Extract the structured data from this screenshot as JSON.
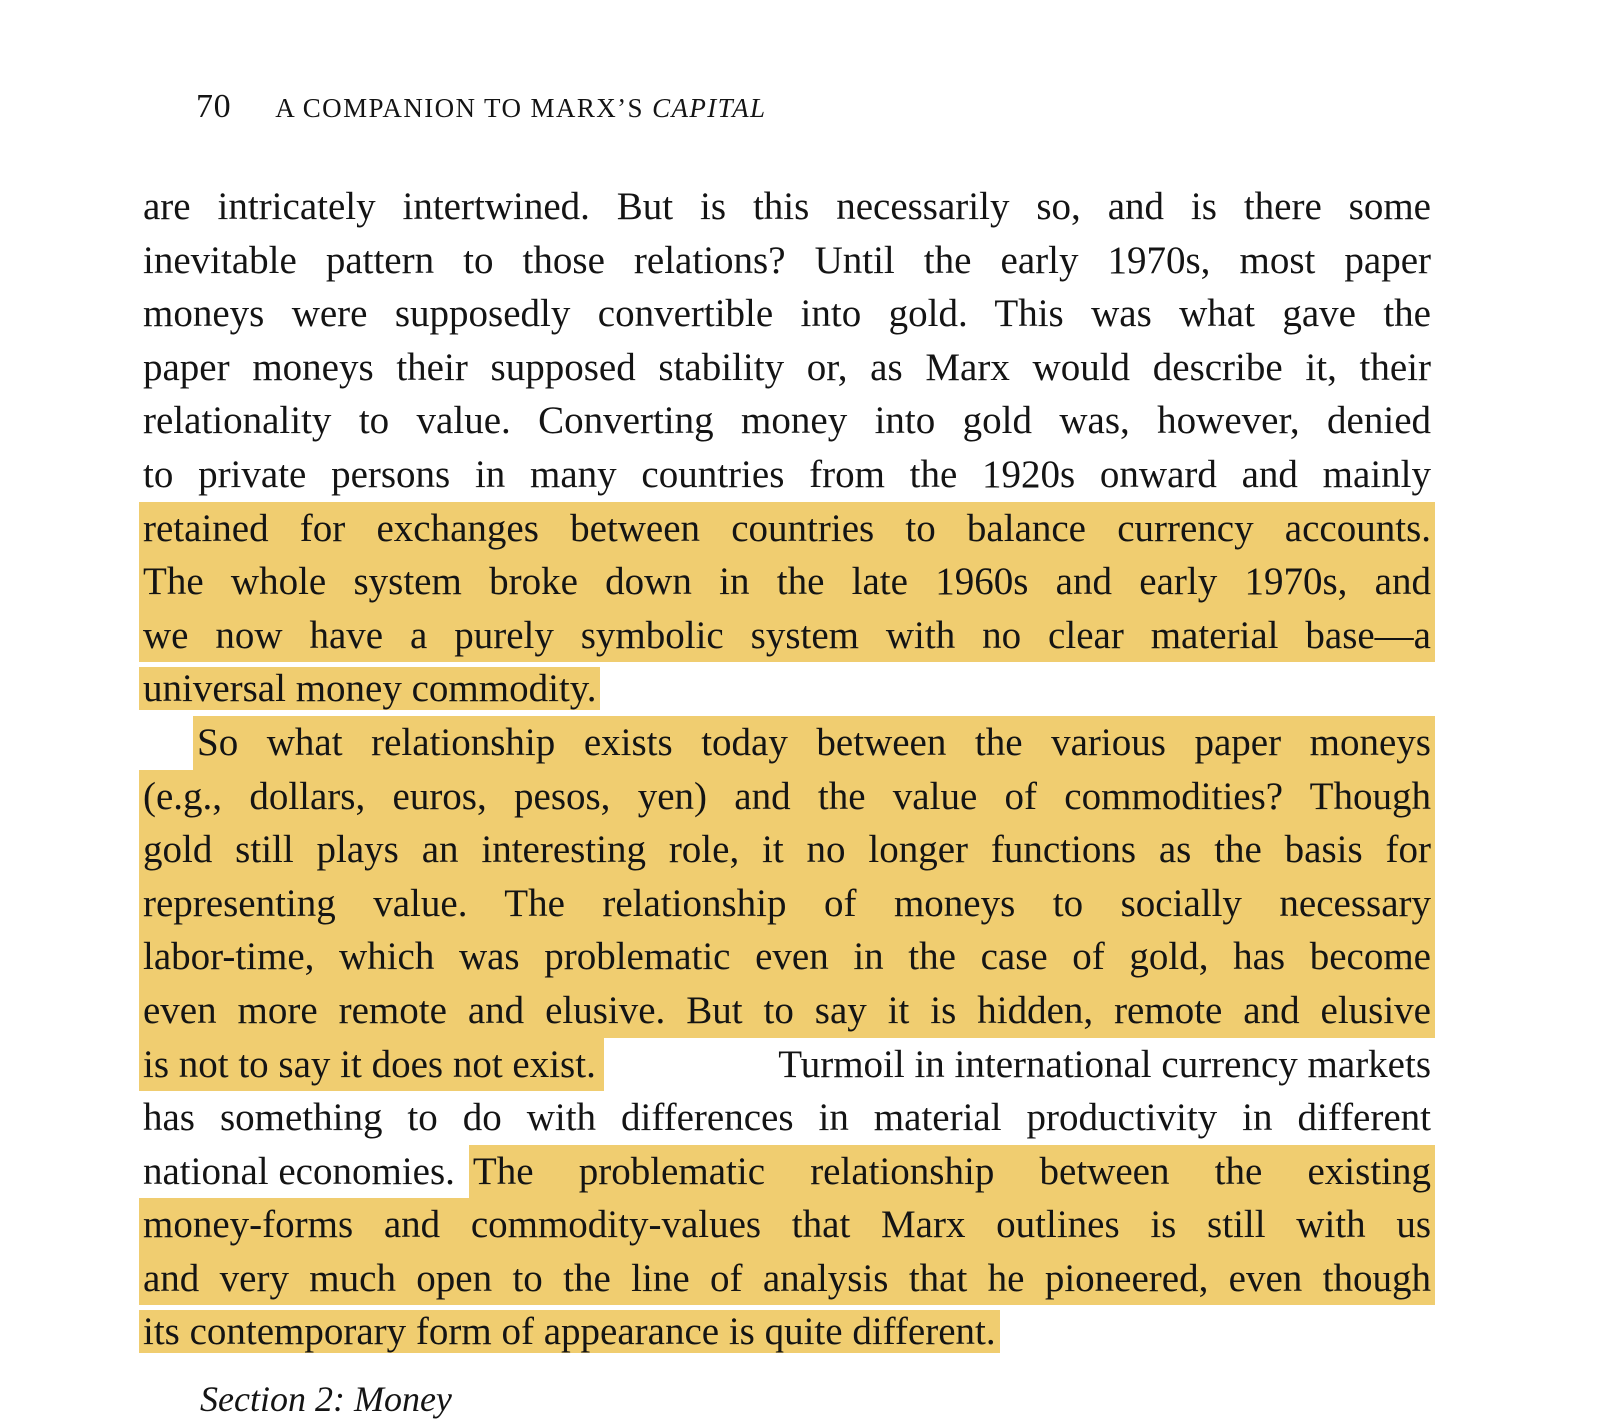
{
  "header": {
    "page_number": "70",
    "title_prefix": "A COMPANION TO MARX’S ",
    "title_italic": "CAPITAL"
  },
  "lines": [
    "are intricately intertwined. But is this necessarily so, and is there some",
    "inevitable pattern to those relations? Until the early 1970s, most paper",
    "moneys were supposedly convertible into gold. This was what gave the",
    "paper moneys their supposed stability or, as Marx would describe it, their",
    "relationality to value. Converting money into gold was, however, denied",
    "to private persons in many countries from the 1920s onward and mainly",
    "retained for exchanges between countries to balance currency accounts.",
    "The whole system broke down in the late 1960s and early 1970s, and",
    "we now have a purely symbolic system with no clear material base—a",
    "universal money commodity.",
    "So what relationship exists today between the various paper moneys",
    "(e.g., dollars, euros, pesos, yen) and the value of commodities? Though",
    "gold still plays an interesting role, it no longer functions as the basis for",
    "representing value. The relationship of moneys to socially necessary",
    "labor-time, which was problematic even in the case of gold, has become",
    "even more remote and elusive. But to say it is hidden, remote and elusive",
    "is not to say it does not exist.",
    " Turmoil in international currency markets",
    "has something to do with differences in material productivity in different",
    "national economies.",
    "The problematic relationship between the existing",
    "money-forms and commodity-values that Marx outlines is still with us",
    "and very much open to the line of analysis that he pioneered, even though",
    "its contemporary form of appearance is quite different."
  ],
  "next_section": "Section 2: Money"
}
